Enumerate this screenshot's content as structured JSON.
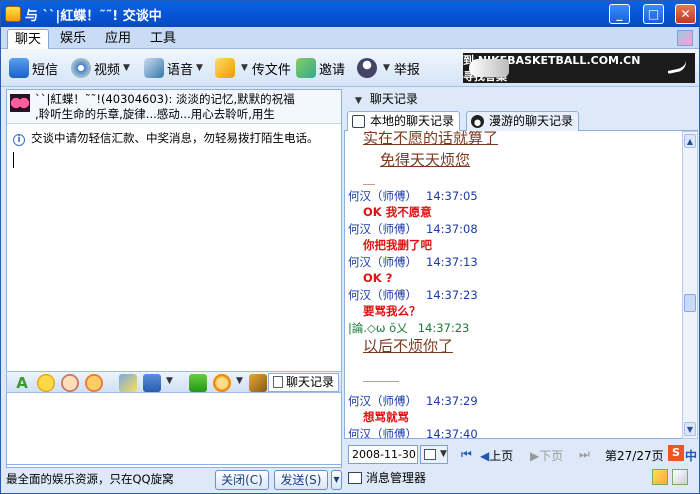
{
  "window": {
    "title": "与 ``|紅蝶！˜˜! 交谈中",
    "controls": [
      "_",
      "□",
      "✕"
    ]
  },
  "menu_tabs": [
    "聊天",
    "娱乐",
    "应用",
    "工具"
  ],
  "toolbar": {
    "sms": "短信",
    "video": "视频",
    "voice": "语音",
    "send_file": "传文件",
    "invite": "邀请",
    "report": "举报"
  },
  "banner": {
    "text": "到 NIKEBASKETBALL.COM.CN 寻找答案"
  },
  "contact": {
    "signature_line1": "``|紅蝶！˜˜!(40304603): 淡淡的记忆,默默的祝福",
    ",signature_line2": ",聆听生命的乐章,旋律...感动...用心去聆听,用生"
  },
  "notice": "交谈中请勿轻信汇款、中奖消息，勿轻易拨打陌生电话。",
  "input_toolbar": {
    "chat_log": "聊天记录"
  },
  "status_text": "最全面的娱乐资源，只在QQ旋窝",
  "buttons": {
    "close": "关闭(C)",
    "send": "发送(S)"
  },
  "history": {
    "header": "聊天记录",
    "tabs": [
      "本地的聊天记录",
      "漫游的聊天记录"
    ],
    "top_cut": "实在不愿的话就算了",
    "top_line2": "免得天天烦您",
    "dash1": "＿",
    "messages": [
      {
        "sender": "何汉（师傅）",
        "time": "14:37:05",
        "text": "OK  我不愿意"
      },
      {
        "sender": "何汉（师傅）",
        "time": "14:37:08",
        "text": "你把我删了吧"
      },
      {
        "sender": "何汉（师傅）",
        "time": "14:37:13",
        "text": "OK  ?"
      },
      {
        "sender": "何汉（师傅）",
        "time": "14:37:23",
        "text": "要骂我么？"
      }
    ],
    "green_sender": "|論.◇ω ŏ乂",
    "green_time": "14:37:23",
    "green_text": "以后不烦你了",
    "dash2": "＿＿＿",
    "messages2": [
      {
        "sender": "何汉（师傅）",
        "time": "14:37:29",
        "text": "想骂就骂"
      },
      {
        "sender": "何汉（师傅）",
        "time": "14:37:40",
        "text": ""
      }
    ]
  },
  "nav": {
    "date": "2008-11-30",
    "prev": "上页",
    "next": "下页",
    "page": "第27/27页"
  },
  "message_manager": "消息管理器"
}
